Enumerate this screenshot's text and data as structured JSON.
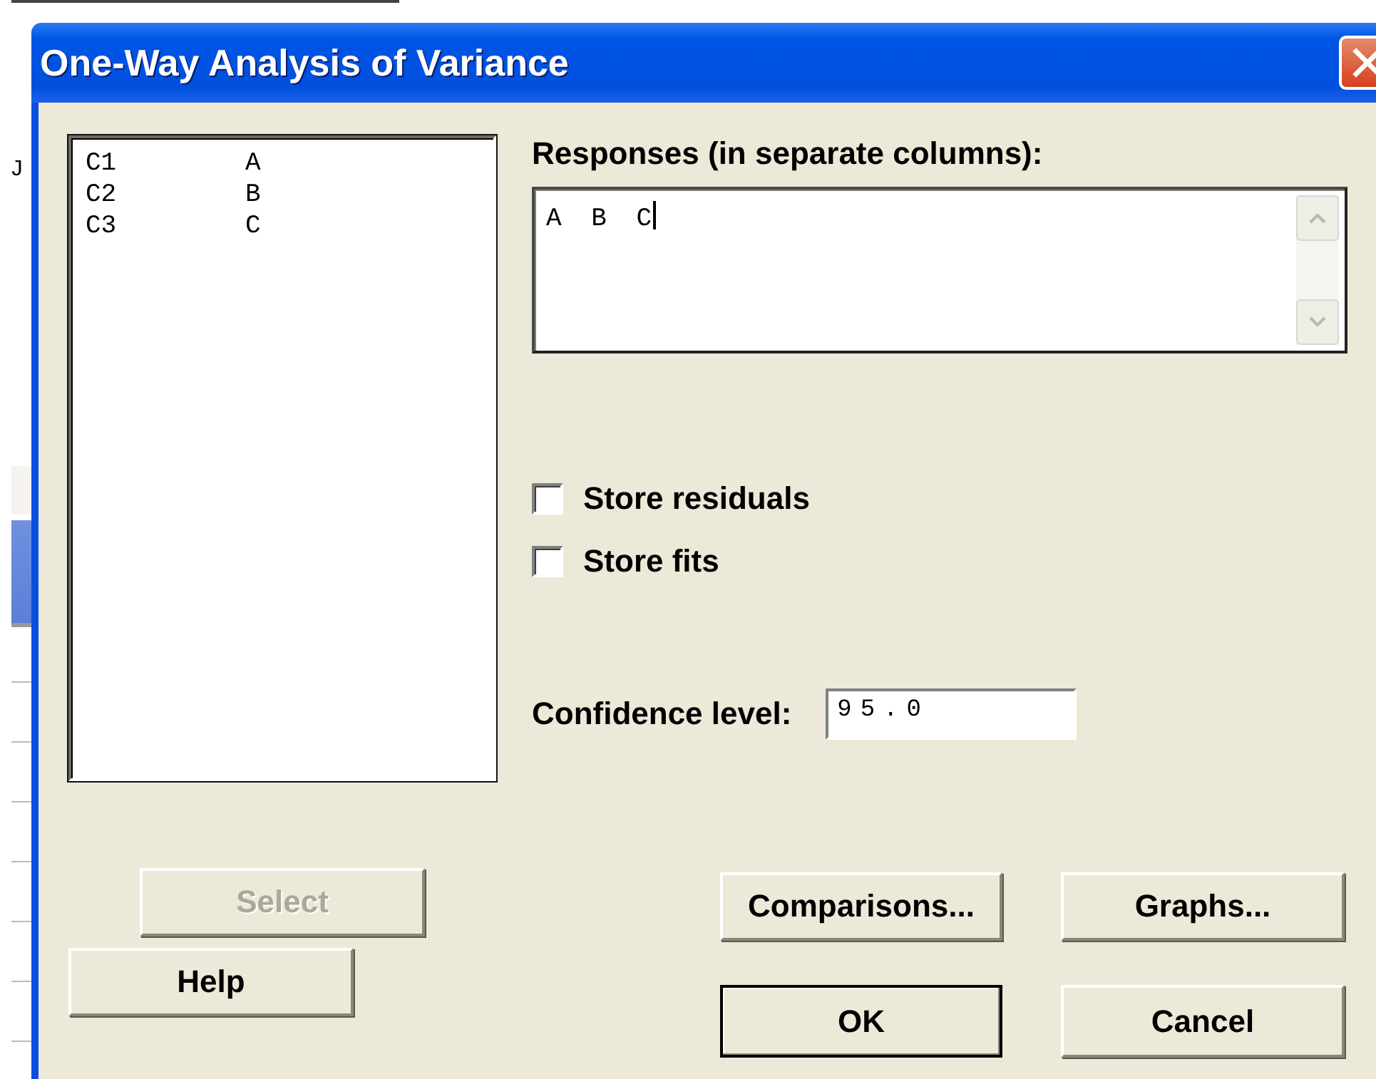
{
  "background": {
    "fragment": "J"
  },
  "window": {
    "title": "One-Way Analysis of Variance"
  },
  "columns_list": [
    {
      "column": "C1",
      "name": "A"
    },
    {
      "column": "C2",
      "name": "B"
    },
    {
      "column": "C3",
      "name": "C"
    }
  ],
  "responses": {
    "label": "Responses (in separate columns):",
    "value": "A B C"
  },
  "options": [
    {
      "label": "Store residuals",
      "checked": false
    },
    {
      "label": "Store fits",
      "checked": false
    }
  ],
  "confidence": {
    "label": "Confidence level:",
    "value": "95.0"
  },
  "left_buttons": [
    {
      "label": "Select",
      "disabled": true,
      "default": false
    },
    {
      "label": "Help",
      "disabled": false,
      "default": false
    }
  ],
  "right_buttons": [
    {
      "label": "Comparisons...",
      "disabled": false,
      "default": false
    },
    {
      "label": "Graphs...",
      "disabled": false,
      "default": false
    },
    {
      "label": "OK",
      "disabled": false,
      "default": true
    },
    {
      "label": "Cancel",
      "disabled": false,
      "default": false
    }
  ]
}
